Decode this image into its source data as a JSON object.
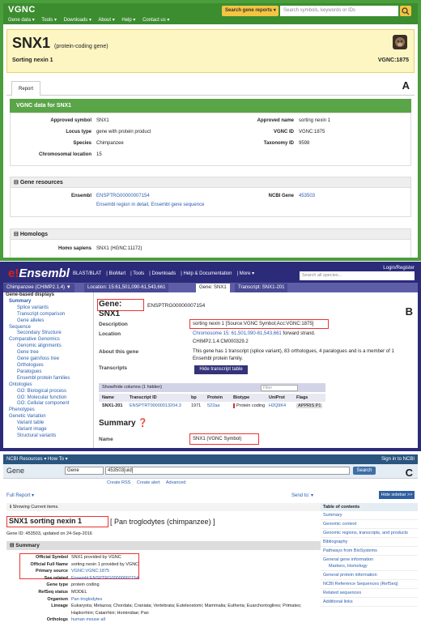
{
  "vgnc": {
    "logo": "VGNC",
    "nav": [
      "Gene data ▾",
      "Tools ▾",
      "Downloads ▾",
      "About ▾",
      "Help ▾",
      "Contact us ▾"
    ],
    "search_button": "Search gene reports ▾",
    "search_placeholder": "Search symbols, keywords or IDs",
    "symbol": "SNX1",
    "type_note": "(protein-coding gene)",
    "name": "Sorting nexin 1",
    "id": "VGNC:1875",
    "tab": "Report",
    "panel_letter": "A",
    "data_header": "VGNC data for SNX1",
    "fields": {
      "approved_symbol_label": "Approved symbol",
      "approved_symbol": "SNX1",
      "approved_name_label": "Approved name",
      "approved_name": "sorting nexin 1",
      "locus_type_label": "Locus type",
      "locus_type": "gene with protein product",
      "vgnc_id_label": "VGNC ID",
      "vgnc_id": "VGNC:1875",
      "species_label": "Species",
      "species": "Chimpanzee",
      "taxonomy_label": "Taxonomy ID",
      "taxonomy": "9598",
      "chrom_label": "Chromosomal location",
      "chrom": "15"
    },
    "gene_resources": {
      "header": "Gene resources",
      "ensembl_label": "Ensembl",
      "ensembl_id": "ENSPTRG00000007154",
      "ensembl_links": "Ensembl region in detail, Ensembl gene sequence",
      "ncbi_label": "NCBI Gene",
      "ncbi_id": "453503"
    },
    "homologs": {
      "header": "Homologs",
      "species_label": "Homo sapiens",
      "value": "SNX1 (HGNC:11172)"
    }
  },
  "ensembl": {
    "logo_e": "e!",
    "logo_rest": "Ensembl",
    "nav": [
      "BLAST/BLAT",
      "BioMart",
      "Tools",
      "Downloads",
      "Help & Documentation",
      "More ▾"
    ],
    "login": "Login/Register",
    "search_placeholder": "Search all species...",
    "tabs": [
      "Chimpanzee (CHIMP2.1.4) ▼",
      "Location: 15:61,501,090-61,543,661",
      "Gene: SNX1",
      "Transcript: SNX1-201"
    ],
    "sidebar": [
      {
        "text": "Gene-based displays",
        "cls": "hd"
      },
      {
        "text": "Summary",
        "cls": "i1 sel"
      },
      {
        "text": "Splice variants",
        "cls": "i2"
      },
      {
        "text": "Transcript comparison",
        "cls": "i2"
      },
      {
        "text": "Gene alleles",
        "cls": "i2"
      },
      {
        "text": "Sequence",
        "cls": "i1"
      },
      {
        "text": "Secondary Structure",
        "cls": "i2"
      },
      {
        "text": "Comparative Genomics",
        "cls": "i1"
      },
      {
        "text": "Genomic alignments",
        "cls": "i2"
      },
      {
        "text": "Gene tree",
        "cls": "i2"
      },
      {
        "text": "Gene gain/loss tree",
        "cls": "i2"
      },
      {
        "text": "Orthologues",
        "cls": "i2"
      },
      {
        "text": "Paralogues",
        "cls": "i2"
      },
      {
        "text": "Ensembl protein families",
        "cls": "i2"
      },
      {
        "text": "Ontologies",
        "cls": "i1"
      },
      {
        "text": "GO: Biological process",
        "cls": "i2"
      },
      {
        "text": "GO: Molecular function",
        "cls": "i2"
      },
      {
        "text": "GO: Cellular component",
        "cls": "i2"
      },
      {
        "text": "Phenotypes",
        "cls": "i1"
      },
      {
        "text": "Genetic Variation",
        "cls": "i1"
      },
      {
        "text": "Variant table",
        "cls": "i2"
      },
      {
        "text": "Variant image",
        "cls": "i2"
      },
      {
        "text": "Structural variants",
        "cls": "i2"
      }
    ],
    "gene_title": "Gene: SNX1",
    "gene_id": "ENSPTRG00000007154",
    "panel_letter": "B",
    "description_label": "Description",
    "description": "sorting nexin 1 [Source:VGNC Symbol;Acc:VGNC:1875]",
    "location_label": "Location",
    "location_link": "Chromosome 15: 61,501,090-61,543,661",
    "location_rest": "forward strand.",
    "assembly": "CHIMP2.1.4:CM000329.2",
    "about_label": "About this gene",
    "about_line1": "This gene has 1 transcript (splice variant), 83 orthologues, 4 paralogues and is a member of 1",
    "about_line2": "Ensembl protein family.",
    "transcripts_label": "Transcripts",
    "hide_button": "Hide transcript table",
    "table_toggle": "Show/hide columns (1 hidden)",
    "filter_placeholder": "Filter",
    "table_headers": [
      "Name",
      "Transcript ID",
      "bp",
      "Protein",
      "Biotype",
      "UniProt",
      "Flags"
    ],
    "table_row": [
      "SNX1-201",
      "ENSPTRT00000013204.3",
      "1971",
      "522aa",
      "Protein coding",
      "H2Q9K4",
      "APPRIS P1"
    ],
    "summary_title": "Summary",
    "name_label": "Name",
    "name_value": "SNX1 (VGNC Symbol)"
  },
  "ncbi": {
    "resources": "NCBI  Resources ▾  How To ▾",
    "signin": "Sign in to NCBI",
    "gene_label": "Gene",
    "db_select": "Gene",
    "query": "453503[uid]",
    "search_button": "Search",
    "sublinks": [
      "Create RSS",
      "Create alert",
      "Advanced"
    ],
    "panel_letter": "C",
    "full_report": "Full Report ▾",
    "send_to": "Send to: ▾",
    "hide_sidebar": "Hide sidebar >>",
    "showing": "Showing Current items.",
    "title": "SNX1  sorting nexin 1",
    "organism": "[ Pan troglodytes (chimpanzee) ]",
    "gene_id_line": "Gene ID: 453503, updated on 24-Sep-2016",
    "summary": "Summary",
    "rows": [
      {
        "label": "Official Symbol",
        "value": "SNX1 provided by VGNC"
      },
      {
        "label": "Official Full Name",
        "value": "sorting nexin 1 provided by VGNC"
      },
      {
        "label": "Primary source",
        "value": "VGNC:VGNC:1875"
      },
      {
        "label": "See related",
        "value": "Ensembl:ENSPTRG00000007154"
      },
      {
        "label": "Gene type",
        "value": "protein coding"
      },
      {
        "label": "RefSeq status",
        "value": "MODEL"
      },
      {
        "label": "Organism",
        "value": "Pan troglodytes"
      },
      {
        "label": "Lineage",
        "value": "Eukaryota; Metazoa; Chordata; Craniata; Vertebrata; Euteleostomi; Mammalia; Eutheria; Euarchontoglires; Primates;"
      },
      {
        "label": "",
        "value": "Haplorrhini; Catarrhini; Hominidae; Pan"
      },
      {
        "label": "Orthologs",
        "value": "human  mouse  all"
      }
    ],
    "toc_header": "Table of contents",
    "toc": [
      "Summary",
      "Genomic context",
      "Genomic regions, transcripts, and products",
      "Bibliography",
      "Pathways from BioSystems",
      "General gene information",
      "Markers, Homology",
      "General protein information",
      "NCBI Reference Sequences (RefSeq)",
      "Related sequences",
      "Additional links"
    ]
  }
}
